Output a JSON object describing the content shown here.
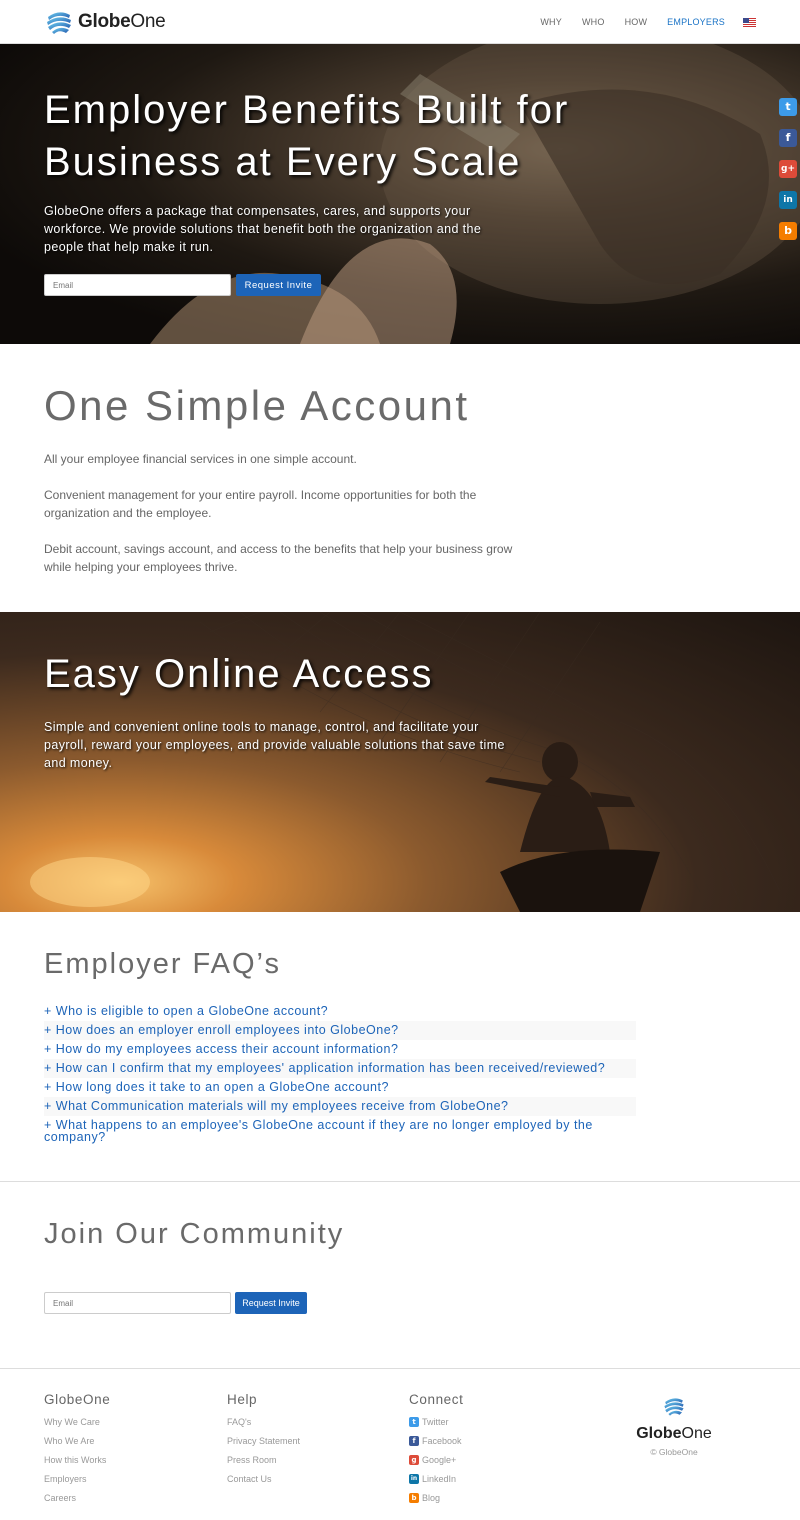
{
  "nav": {
    "brand_bold": "Globe",
    "brand_light": "One",
    "links": [
      {
        "label": "WHY"
      },
      {
        "label": "WHO"
      },
      {
        "label": "HOW"
      },
      {
        "label": "EMPLOYERS"
      }
    ],
    "active_index": 3
  },
  "hero": {
    "title": "Employer Benefits Built for Business at Every Scale",
    "text": "GlobeOne offers a package that compensates, cares, and supports your workforce. We provide solutions that benefit both the organization and the people that help make it run.",
    "email_placeholder": "Email",
    "button": "Request Invite"
  },
  "social": [
    {
      "name": "twitter-icon",
      "glyph": "t",
      "color": "#3d9be9"
    },
    {
      "name": "facebook-icon",
      "glyph": "f",
      "color": "#3b5998"
    },
    {
      "name": "google-plus-icon",
      "glyph": "g+",
      "color": "#dd4b39"
    },
    {
      "name": "linkedin-icon",
      "glyph": "in",
      "color": "#0e76a8"
    },
    {
      "name": "blog-icon",
      "glyph": "b",
      "color": "#f57d00"
    }
  ],
  "account": {
    "title": "One Simple Account",
    "paragraphs": [
      "All your employee financial services in one simple account.",
      "Convenient management for your entire payroll. Income opportunities for both the organization and the employee.",
      "Debit account, savings account, and access to the benefits that help your business grow while helping your employees thrive."
    ]
  },
  "access": {
    "title": "Easy Online Access",
    "text": "Simple and convenient online tools to manage, control, and facilitate your payroll, reward your employees, and provide valuable solutions that save time and money."
  },
  "faq": {
    "title": "Employer FAQ’s",
    "items": [
      "+ Who is eligible to open a GlobeOne account?",
      "+ How does an employer enroll employees into GlobeOne?",
      "+ How do my employees access their account information?",
      "+ How can I confirm that my employees' application information has been received/reviewed?",
      "+ How long does it take to an open a GlobeOne account?",
      "+ What Communication materials will my employees receive from GlobeOne?",
      "+ What happens to an employee's GlobeOne account if they are no longer employed by the company?"
    ]
  },
  "join": {
    "title": "Join Our Community",
    "email_placeholder": "Email",
    "button": "Request Invite"
  },
  "footer": {
    "col1": {
      "title": "GlobeOne",
      "links": [
        "Why We Care",
        "Who We Are",
        "How this Works",
        "Employers",
        "Careers"
      ]
    },
    "col2": {
      "title": "Help",
      "links": [
        "FAQ's",
        "Privacy Statement",
        "Press Room",
        "Contact Us"
      ]
    },
    "col3": {
      "title": "Connect",
      "links": [
        {
          "label": "Twitter",
          "icon": "twitter-icon",
          "glyph": "t",
          "color": "#3d9be9"
        },
        {
          "label": "Facebook",
          "icon": "facebook-icon",
          "glyph": "f",
          "color": "#3b5998"
        },
        {
          "label": "Google+",
          "icon": "google-plus-icon",
          "glyph": "g",
          "color": "#dd4b39"
        },
        {
          "label": "LinkedIn",
          "icon": "linkedin-icon",
          "glyph": "in",
          "color": "#0e76a8"
        },
        {
          "label": "Blog",
          "icon": "blog-icon",
          "glyph": "b",
          "color": "#f57d00"
        }
      ]
    },
    "brand_bold": "Globe",
    "brand_light": "One",
    "copyright": "© GlobeOne"
  },
  "colors": {
    "accent": "#1d64b8",
    "nav_active": "#1a73c6"
  }
}
